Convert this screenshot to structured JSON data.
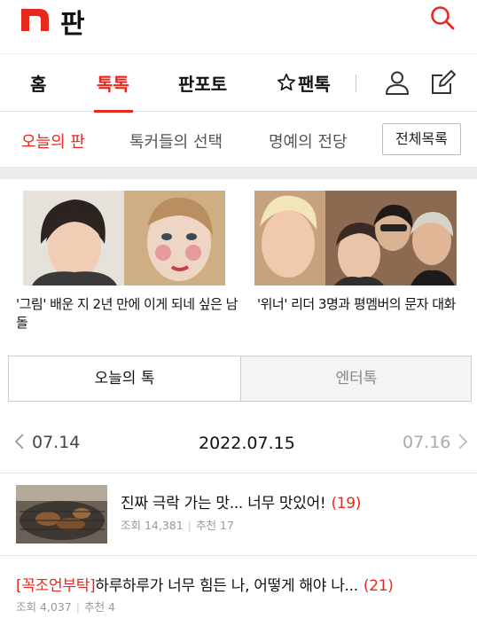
{
  "header": {
    "logo_text": "판",
    "accent": "#e8271f"
  },
  "nav": {
    "tabs": [
      {
        "label": "홈"
      },
      {
        "label": "톡톡"
      },
      {
        "label": "판포토"
      },
      {
        "label": "팬톡"
      }
    ],
    "active_tab": "톡톡",
    "icons": [
      "search-icon",
      "user-icon",
      "edit-icon",
      "star-icon"
    ]
  },
  "subnav": {
    "items": [
      {
        "label": "오늘의 판"
      },
      {
        "label": "톡커들의 선택"
      },
      {
        "label": "명예의 전당"
      }
    ],
    "all_list_label": "전체목록"
  },
  "cards": [
    {
      "title": "'그림' 배운 지 2년 만에 이게 되네 싶은 남돌"
    },
    {
      "title": "'위너' 리더 3명과 평멤버의 문자 대화"
    }
  ],
  "segment": {
    "active_label": "오늘의 톡",
    "inactive_label": "엔터톡"
  },
  "datebar": {
    "prev": "07.14",
    "current": "2022.07.15",
    "next": "07.16"
  },
  "posts": [
    {
      "title": "진짜 극락 가는 맛... 너무 맛있어!",
      "comments": "(19)",
      "views_label": "조회 14,381",
      "recommend_label": "추천 17"
    },
    {
      "tag": "[꼭조언부탁]",
      "title": "하루하루가 너무 힘든 나, 어떻게 해야 나...",
      "comments": "(21)",
      "views_label": "조회 4,037",
      "recommend_label": "추천 4"
    }
  ]
}
